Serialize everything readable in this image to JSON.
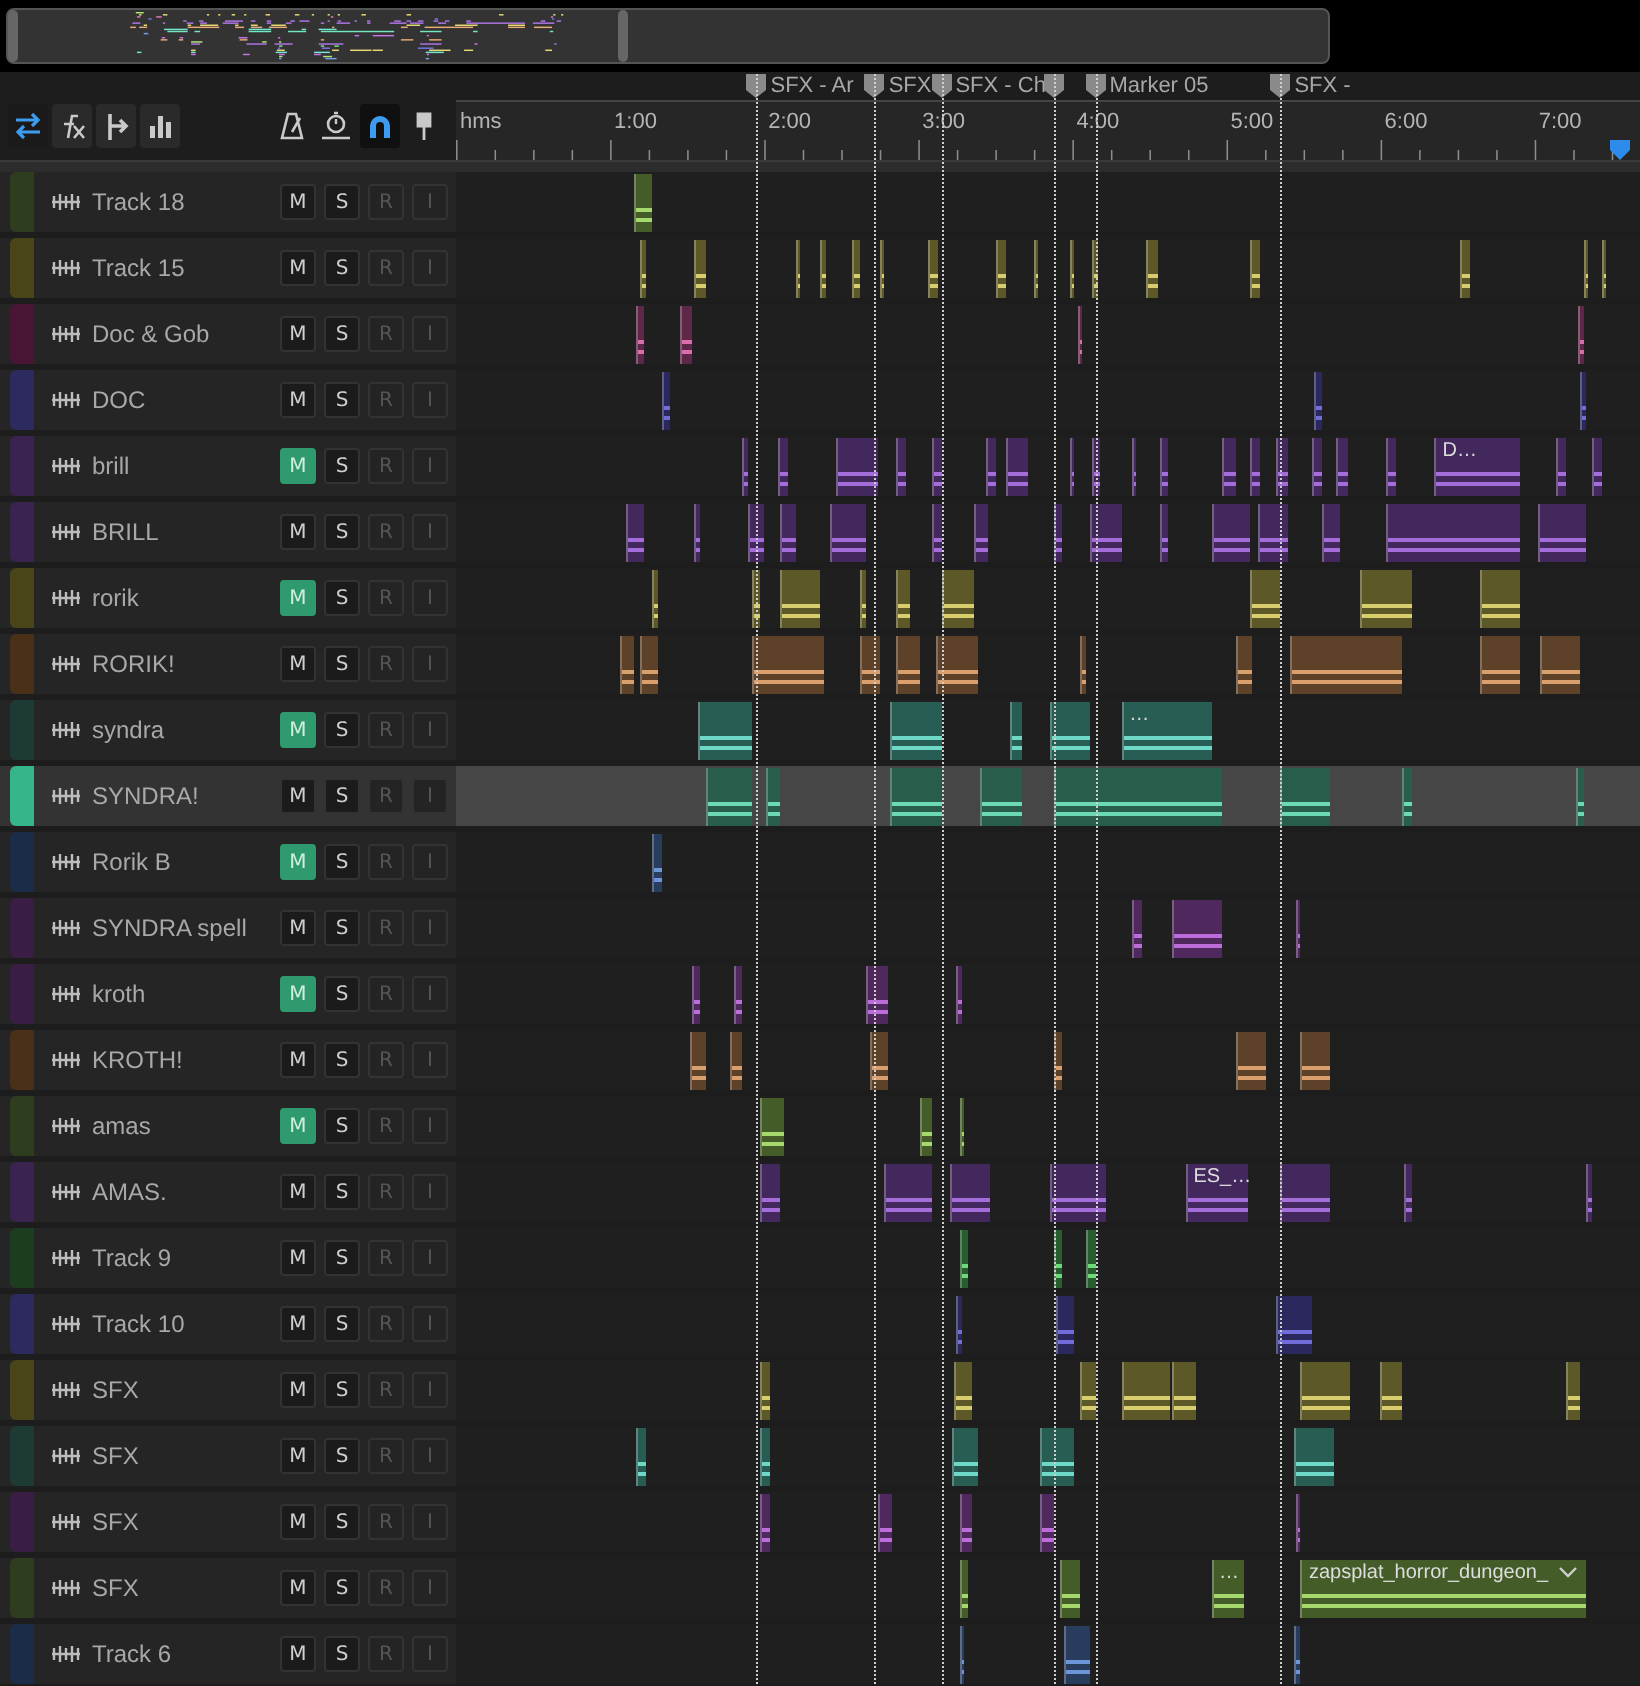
{
  "view_tools": [
    {
      "kind": "inputs-outputs",
      "selected": true
    },
    {
      "kind": "effects",
      "selected": false
    },
    {
      "kind": "sends",
      "selected": false
    },
    {
      "kind": "eq",
      "selected": false
    }
  ],
  "snap_tools": [
    {
      "kind": "metronome",
      "selected": false
    },
    {
      "kind": "time-stretch",
      "selected": false
    },
    {
      "kind": "snap",
      "selected": true
    },
    {
      "kind": "marker",
      "selected": false
    }
  ],
  "ruler": {
    "labels": [
      "hms",
      "1:00",
      "2:00",
      "3:00",
      "4:00",
      "5:00",
      "6:00",
      "7:00"
    ]
  },
  "markers": [
    {
      "kind": "cue",
      "label": "SFX - Ar"
    },
    {
      "kind": "cue",
      "label": "SFX"
    },
    {
      "kind": "cue",
      "label": "SFX - Ch"
    },
    {
      "kind": "cue"
    },
    {
      "kind": "cue",
      "label": "Marker 05"
    },
    {
      "kind": "cue",
      "label": "SFX -"
    }
  ],
  "tracks": [
    {
      "name": "Track 18",
      "color": "#2f3d1f",
      "selected": false,
      "buttons": [
        {
          "label": "M",
          "on": false,
          "disabled": false
        },
        {
          "label": "S",
          "on": false,
          "disabled": false
        },
        {
          "label": "R",
          "on": false,
          "disabled": true
        },
        {
          "label": "I",
          "on": false,
          "disabled": true
        }
      ]
    },
    {
      "name": "Track 15",
      "color": "#4a4519",
      "selected": false,
      "buttons": [
        {
          "label": "M",
          "on": false,
          "disabled": false
        },
        {
          "label": "S",
          "on": false,
          "disabled": false
        },
        {
          "label": "R",
          "on": false,
          "disabled": true
        },
        {
          "label": "I",
          "on": false,
          "disabled": true
        }
      ]
    },
    {
      "name": "Doc & Gob",
      "color": "#4a1535",
      "selected": false,
      "buttons": [
        {
          "label": "M",
          "on": false,
          "disabled": false
        },
        {
          "label": "S",
          "on": false,
          "disabled": false
        },
        {
          "label": "R",
          "on": false,
          "disabled": true
        },
        {
          "label": "I",
          "on": false,
          "disabled": true
        }
      ]
    },
    {
      "name": "DOC",
      "color": "#2c2a5e",
      "selected": false,
      "buttons": [
        {
          "label": "M",
          "on": false,
          "disabled": false
        },
        {
          "label": "S",
          "on": false,
          "disabled": false
        },
        {
          "label": "R",
          "on": false,
          "disabled": true
        },
        {
          "label": "I",
          "on": false,
          "disabled": true
        }
      ]
    },
    {
      "name": "brill",
      "color": "#3a2350",
      "selected": false,
      "buttons": [
        {
          "label": "M",
          "on": true,
          "disabled": false
        },
        {
          "label": "S",
          "on": false,
          "disabled": false
        },
        {
          "label": "R",
          "on": false,
          "disabled": true
        },
        {
          "label": "I",
          "on": false,
          "disabled": true
        }
      ],
      "clips": [
        {
          "label": "D…",
          "menu": false
        }
      ]
    },
    {
      "name": "BRILL",
      "color": "#3a2350",
      "selected": false,
      "buttons": [
        {
          "label": "M",
          "on": false,
          "disabled": false
        },
        {
          "label": "S",
          "on": false,
          "disabled": false
        },
        {
          "label": "R",
          "on": false,
          "disabled": true
        },
        {
          "label": "I",
          "on": false,
          "disabled": true
        }
      ]
    },
    {
      "name": "rorik",
      "color": "#4a4519",
      "selected": false,
      "buttons": [
        {
          "label": "M",
          "on": true,
          "disabled": false
        },
        {
          "label": "S",
          "on": false,
          "disabled": false
        },
        {
          "label": "R",
          "on": false,
          "disabled": true
        },
        {
          "label": "I",
          "on": false,
          "disabled": true
        }
      ]
    },
    {
      "name": "RORIK!",
      "color": "#4a3018",
      "selected": false,
      "buttons": [
        {
          "label": "M",
          "on": false,
          "disabled": false
        },
        {
          "label": "S",
          "on": false,
          "disabled": false
        },
        {
          "label": "R",
          "on": false,
          "disabled": true
        },
        {
          "label": "I",
          "on": false,
          "disabled": true
        }
      ]
    },
    {
      "name": "syndra",
      "color": "#1d3a35",
      "selected": false,
      "buttons": [
        {
          "label": "M",
          "on": true,
          "disabled": false
        },
        {
          "label": "S",
          "on": false,
          "disabled": false
        },
        {
          "label": "R",
          "on": false,
          "disabled": true
        },
        {
          "label": "I",
          "on": false,
          "disabled": true
        }
      ],
      "clips": [
        {
          "label": "…",
          "menu": false
        }
      ]
    },
    {
      "name": "SYNDRA!",
      "color": "#35b58a",
      "selected": true,
      "buttons": [
        {
          "label": "M",
          "on": false,
          "disabled": false
        },
        {
          "label": "S",
          "on": false,
          "disabled": false
        },
        {
          "label": "R",
          "on": false,
          "disabled": true
        },
        {
          "label": "I",
          "on": false,
          "disabled": true
        }
      ]
    },
    {
      "name": "Rorik B",
      "color": "#1b2c48",
      "selected": false,
      "buttons": [
        {
          "label": "M",
          "on": true,
          "disabled": false
        },
        {
          "label": "S",
          "on": false,
          "disabled": false
        },
        {
          "label": "R",
          "on": false,
          "disabled": true
        },
        {
          "label": "I",
          "on": false,
          "disabled": true
        }
      ]
    },
    {
      "name": "SYNDRA spell",
      "color": "#3a1d45",
      "selected": false,
      "buttons": [
        {
          "label": "M",
          "on": false,
          "disabled": false
        },
        {
          "label": "S",
          "on": false,
          "disabled": false
        },
        {
          "label": "R",
          "on": false,
          "disabled": true
        },
        {
          "label": "I",
          "on": false,
          "disabled": true
        }
      ]
    },
    {
      "name": "kroth",
      "color": "#3a1d45",
      "selected": false,
      "buttons": [
        {
          "label": "M",
          "on": true,
          "disabled": false
        },
        {
          "label": "S",
          "on": false,
          "disabled": false
        },
        {
          "label": "R",
          "on": false,
          "disabled": true
        },
        {
          "label": "I",
          "on": false,
          "disabled": true
        }
      ]
    },
    {
      "name": "KROTH!",
      "color": "#4a3018",
      "selected": false,
      "buttons": [
        {
          "label": "M",
          "on": false,
          "disabled": false
        },
        {
          "label": "S",
          "on": false,
          "disabled": false
        },
        {
          "label": "R",
          "on": false,
          "disabled": true
        },
        {
          "label": "I",
          "on": false,
          "disabled": true
        }
      ]
    },
    {
      "name": "amas",
      "color": "#2f3d1f",
      "selected": false,
      "buttons": [
        {
          "label": "M",
          "on": true,
          "disabled": false
        },
        {
          "label": "S",
          "on": false,
          "disabled": false
        },
        {
          "label": "R",
          "on": false,
          "disabled": true
        },
        {
          "label": "I",
          "on": false,
          "disabled": true
        }
      ]
    },
    {
      "name": "AMAS.",
      "color": "#3a2350",
      "selected": false,
      "buttons": [
        {
          "label": "M",
          "on": false,
          "disabled": false
        },
        {
          "label": "S",
          "on": false,
          "disabled": false
        },
        {
          "label": "R",
          "on": false,
          "disabled": true
        },
        {
          "label": "I",
          "on": false,
          "disabled": true
        }
      ],
      "clips": [
        {
          "label": "ES_…",
          "menu": false
        }
      ]
    },
    {
      "name": "Track 9",
      "color": "#1d3d20",
      "selected": false,
      "buttons": [
        {
          "label": "M",
          "on": false,
          "disabled": false
        },
        {
          "label": "S",
          "on": false,
          "disabled": false
        },
        {
          "label": "R",
          "on": false,
          "disabled": true
        },
        {
          "label": "I",
          "on": false,
          "disabled": true
        }
      ]
    },
    {
      "name": "Track 10",
      "color": "#2c2a5e",
      "selected": false,
      "buttons": [
        {
          "label": "M",
          "on": false,
          "disabled": false
        },
        {
          "label": "S",
          "on": false,
          "disabled": false
        },
        {
          "label": "R",
          "on": false,
          "disabled": true
        },
        {
          "label": "I",
          "on": false,
          "disabled": true
        }
      ]
    },
    {
      "name": "SFX",
      "color": "#4a4519",
      "selected": false,
      "buttons": [
        {
          "label": "M",
          "on": false,
          "disabled": false
        },
        {
          "label": "S",
          "on": false,
          "disabled": false
        },
        {
          "label": "R",
          "on": false,
          "disabled": true
        },
        {
          "label": "I",
          "on": false,
          "disabled": true
        }
      ]
    },
    {
      "name": "SFX",
      "color": "#1d3a35",
      "selected": false,
      "buttons": [
        {
          "label": "M",
          "on": false,
          "disabled": false
        },
        {
          "label": "S",
          "on": false,
          "disabled": false
        },
        {
          "label": "R",
          "on": false,
          "disabled": true
        },
        {
          "label": "I",
          "on": false,
          "disabled": true
        }
      ]
    },
    {
      "name": "SFX",
      "color": "#3a1d45",
      "selected": false,
      "buttons": [
        {
          "label": "M",
          "on": false,
          "disabled": false
        },
        {
          "label": "S",
          "on": false,
          "disabled": false
        },
        {
          "label": "R",
          "on": false,
          "disabled": true
        },
        {
          "label": "I",
          "on": false,
          "disabled": true
        }
      ]
    },
    {
      "name": "SFX",
      "color": "#2f3d1f",
      "selected": false,
      "buttons": [
        {
          "label": "M",
          "on": false,
          "disabled": false
        },
        {
          "label": "S",
          "on": false,
          "disabled": false
        },
        {
          "label": "R",
          "on": false,
          "disabled": true
        },
        {
          "label": "I",
          "on": false,
          "disabled": true
        }
      ],
      "clips": [
        {
          "label": "…",
          "menu": false
        },
        {
          "label": "zapsplat_horror_dungeon_",
          "menu": true
        }
      ]
    },
    {
      "name": "Track 6",
      "color": "#1b2c48",
      "selected": false,
      "buttons": [
        {
          "label": "M",
          "on": false,
          "disabled": false
        },
        {
          "label": "S",
          "on": false,
          "disabled": false
        },
        {
          "label": "R",
          "on": false,
          "disabled": true
        },
        {
          "label": "I",
          "on": false,
          "disabled": true
        }
      ]
    }
  ]
}
